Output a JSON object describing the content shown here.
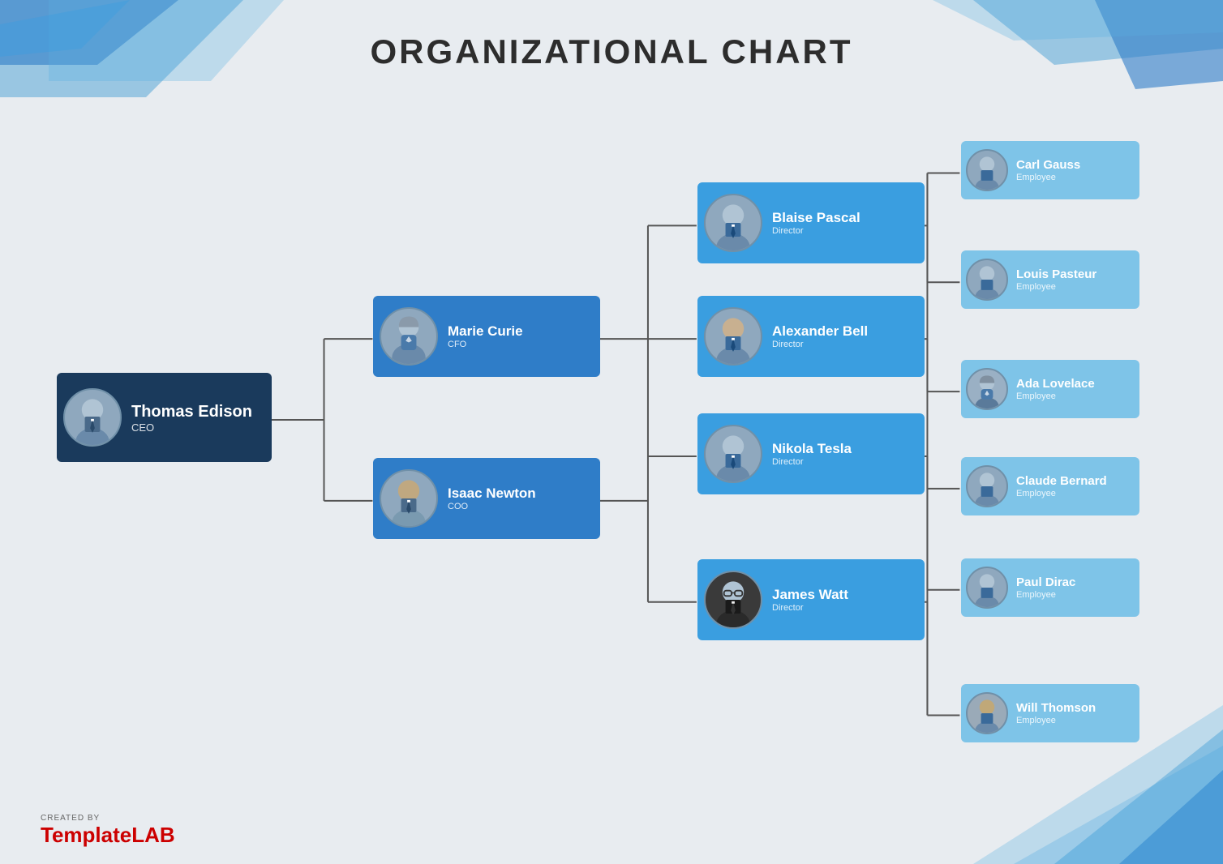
{
  "title": "ORGANIZATIONAL CHART",
  "colors": {
    "ceo_bg": "#1a3a5c",
    "level2_bg": "#2f7dc8",
    "director_bg": "#3a9ee0",
    "employee_bg": "#7ec4e8",
    "avatar_bg": "#8fa8be",
    "line_color": "#555"
  },
  "nodes": {
    "ceo": {
      "name": "Thomas Edison",
      "role": "CEO"
    },
    "level2": [
      {
        "name": "Marie Curie",
        "role": "CFO"
      },
      {
        "name": "Isaac Newton",
        "role": "COO"
      }
    ],
    "directors": [
      {
        "name": "Blaise Pascal",
        "role": "Director"
      },
      {
        "name": "Alexander Bell",
        "role": "Director"
      },
      {
        "name": "Nikola Tesla",
        "role": "Director"
      },
      {
        "name": "James Watt",
        "role": "Director"
      }
    ],
    "employees": [
      {
        "name": "Carl Gauss",
        "role": "Employee"
      },
      {
        "name": "Louis Pasteur",
        "role": "Employee"
      },
      {
        "name": "Ada Lovelace",
        "role": "Employee"
      },
      {
        "name": "Claude Bernard",
        "role": "Employee"
      },
      {
        "name": "Paul Dirac",
        "role": "Employee"
      },
      {
        "name": "Will Thomson",
        "role": "Employee"
      }
    ]
  },
  "footer": {
    "created_by": "CREATED BY",
    "brand_regular": "Template",
    "brand_bold": "LAB"
  }
}
